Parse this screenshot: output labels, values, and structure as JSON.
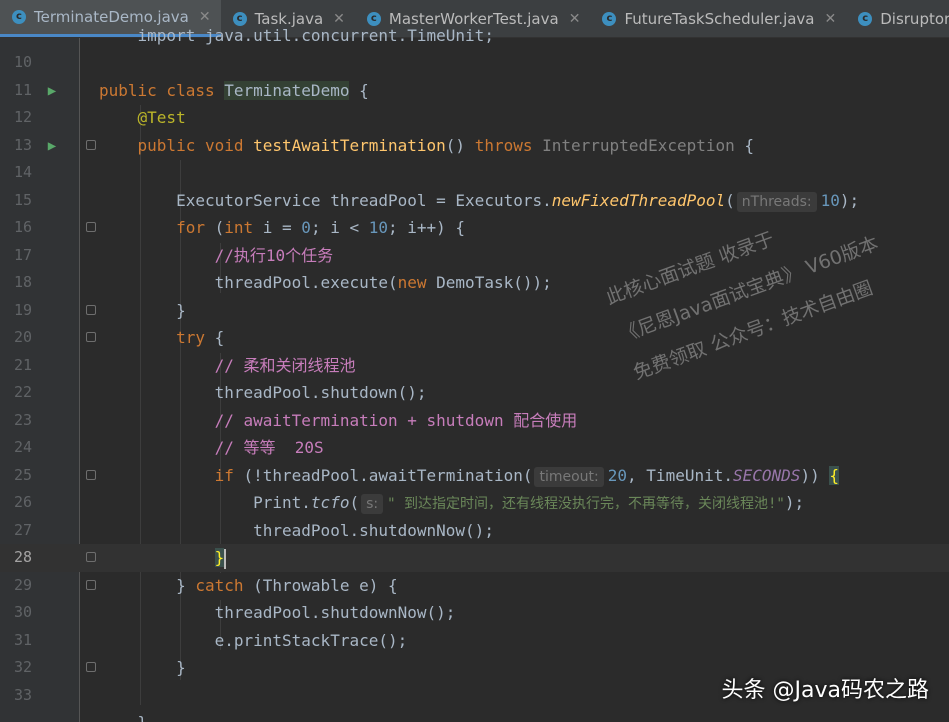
{
  "tabs": [
    {
      "label": "TerminateDemo.java",
      "active": true,
      "icon": "class-icon"
    },
    {
      "label": "Task.java",
      "active": false,
      "icon": "class-icon"
    },
    {
      "label": "MasterWorkerTest.java",
      "active": false,
      "icon": "class-icon"
    },
    {
      "label": "FutureTaskScheduler.java",
      "active": false,
      "icon": "class-icon"
    },
    {
      "label": "DisruptorTas",
      "active": false,
      "icon": "class-icon"
    }
  ],
  "code": {
    "l9": "import java.util.concurrent.TimeUnit;",
    "l11_kw": "public class ",
    "l11_cls": "TerminateDemo",
    "l11_rest": " {",
    "l12": "@Test",
    "l13_kw": "public void ",
    "l13_fn": "testAwaitTermination",
    "l13_mid": "() ",
    "l13_throws": "throws ",
    "l13_exc": "InterruptedException",
    "l13_end": " {",
    "l15_a": "ExecutorService threadPool = Executors.",
    "l15_fn": "newFixedThreadPool",
    "l15_b": "(",
    "l15_hint": "nThreads:",
    "l15_num": "10",
    "l15_end": ");",
    "l16_kw": "for ",
    "l16_a": "(",
    "l16_int": "int ",
    "l16_b": "i = ",
    "l16_0": "0",
    "l16_c": "; i < ",
    "l16_10": "10",
    "l16_d": "; i++) {",
    "l17": "//执行10个任务",
    "l18_a": "threadPool.execute(",
    "l18_new": "new ",
    "l18_b": "DemoTask());",
    "l19": "}",
    "l20_kw": "try ",
    "l20_b": "{",
    "l21": "// 柔和关闭线程池",
    "l22": "threadPool.shutdown();",
    "l23": "// awaitTermination + shutdown 配合使用",
    "l24": "// 等等  20S",
    "l25_kw": "if ",
    "l25_a": "(!threadPool.awaitTermination(",
    "l25_hint": "timeout:",
    "l25_num": "20",
    "l25_b": ", TimeUnit.",
    "l25_field": "SECONDS",
    "l25_c": ")) ",
    "l25_brace": "{",
    "l26_a": "Print.",
    "l26_fn": "tcfo",
    "l26_b": "(",
    "l26_hint": "s:",
    "l26_str": "\" 到达指定时间，还有线程没执行完，不再等待，关闭线程池!\"",
    "l26_end": ");",
    "l27": "threadPool.shutdownNow();",
    "l28": "}",
    "l29_a": "} ",
    "l29_kw": "catch ",
    "l29_b": "(Throwable e) {",
    "l30": "threadPool.shutdownNow();",
    "l31": "e.printStackTrace();",
    "l32": "}",
    "l34": "}"
  },
  "line_numbers": [
    "10",
    "11",
    "12",
    "13",
    "14",
    "15",
    "16",
    "17",
    "18",
    "19",
    "20",
    "21",
    "22",
    "23",
    "24",
    "25",
    "26",
    "27",
    "28",
    "29",
    "30",
    "31",
    "32",
    "33"
  ],
  "watermark": {
    "line1": "此核心面试题 收录于",
    "line2": "《尼恩Java面试宝典》 V60版本",
    "line3": "免费领取 公众号：技术自由圈"
  },
  "footer_brand": "头条 @Java码农之路",
  "colors": {
    "background": "#2b2b2b",
    "keyword": "#cc7832",
    "comment": "#c77dbb",
    "number": "#6897bb",
    "string": "#6a8759",
    "function": "#ffc66d",
    "annotation": "#bbb529"
  }
}
